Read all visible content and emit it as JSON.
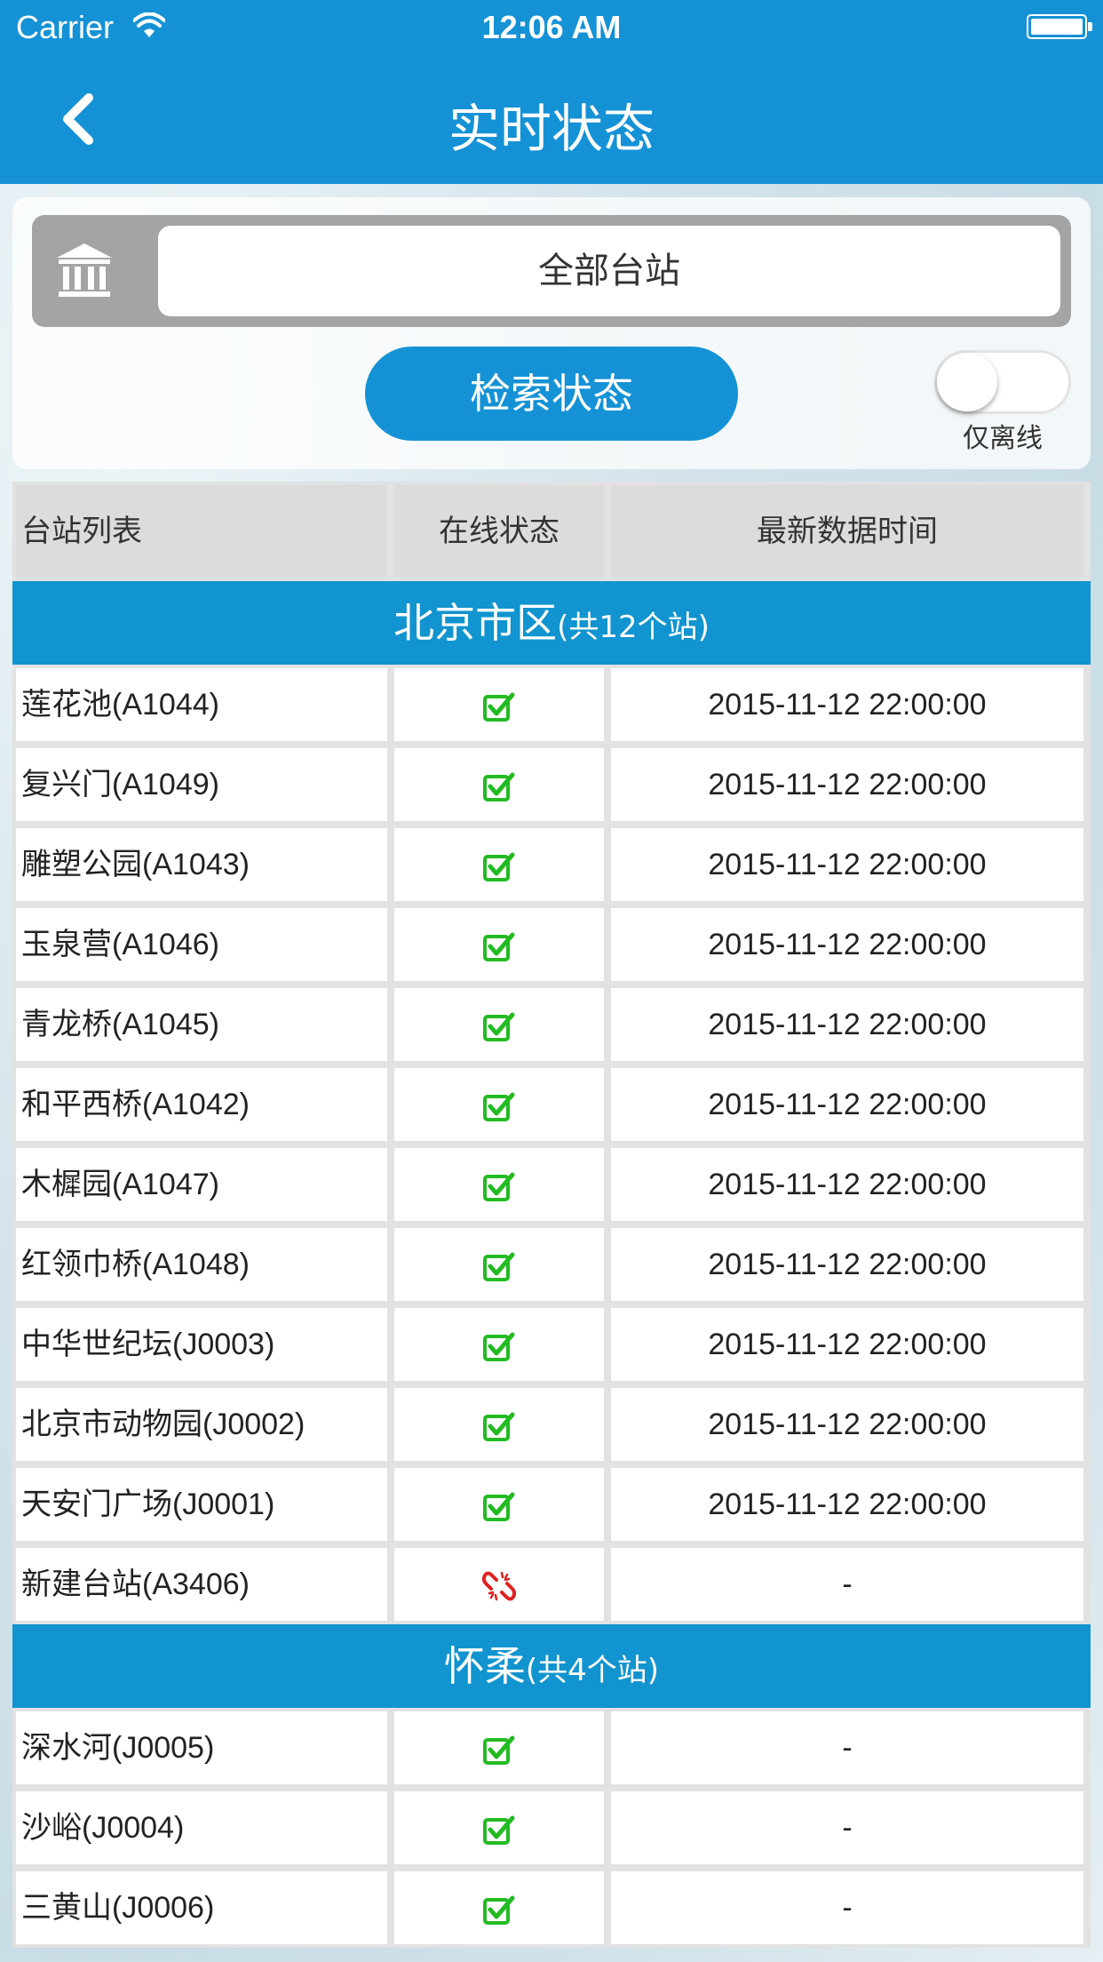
{
  "status_bar": {
    "carrier": "Carrier",
    "time": "12:06 AM"
  },
  "nav": {
    "title": "实时状态"
  },
  "filter": {
    "station_value": "全部台站",
    "search_button": "检索状态",
    "toggle_label": "仅离线"
  },
  "table": {
    "headers": [
      "台站列表",
      "在线状态",
      "最新数据时间"
    ],
    "groups": [
      {
        "name": "北京市区",
        "count": "(共12个站)",
        "rows": [
          {
            "station": "莲花池(A1044)",
            "online": true,
            "time": "2015-11-12 22:00:00"
          },
          {
            "station": "复兴门(A1049)",
            "online": true,
            "time": "2015-11-12 22:00:00"
          },
          {
            "station": "雕塑公园(A1043)",
            "online": true,
            "time": "2015-11-12 22:00:00"
          },
          {
            "station": "玉泉营(A1046)",
            "online": true,
            "time": "2015-11-12 22:00:00"
          },
          {
            "station": "青龙桥(A1045)",
            "online": true,
            "time": "2015-11-12 22:00:00"
          },
          {
            "station": "和平西桥(A1042)",
            "online": true,
            "time": "2015-11-12 22:00:00"
          },
          {
            "station": "木樨园(A1047)",
            "online": true,
            "time": "2015-11-12 22:00:00"
          },
          {
            "station": "红领巾桥(A1048)",
            "online": true,
            "time": "2015-11-12 22:00:00"
          },
          {
            "station": "中华世纪坛(J0003)",
            "online": true,
            "time": "2015-11-12 22:00:00"
          },
          {
            "station": "北京市动物园(J0002)",
            "online": true,
            "time": "2015-11-12 22:00:00"
          },
          {
            "station": "天安门广场(J0001)",
            "online": true,
            "time": "2015-11-12 22:00:00"
          },
          {
            "station": "新建台站(A3406)",
            "online": false,
            "time": "-"
          }
        ]
      },
      {
        "name": "怀柔",
        "count": "(共4个站)",
        "rows": [
          {
            "station": "深水河(J0005)",
            "online": true,
            "time": "-"
          },
          {
            "station": "沙峪(J0004)",
            "online": true,
            "time": "-"
          },
          {
            "station": "三黄山(J0006)",
            "online": true,
            "time": "-"
          }
        ]
      }
    ]
  },
  "colors": {
    "primary": "#1592d6",
    "group_header": "#1194cf",
    "online_check": "#22bb22",
    "offline": "#e02020"
  },
  "icons": {
    "online": "checkbox-check-icon",
    "offline": "broken-link-icon",
    "station": "bank-icon",
    "back": "chevron-left-icon"
  }
}
